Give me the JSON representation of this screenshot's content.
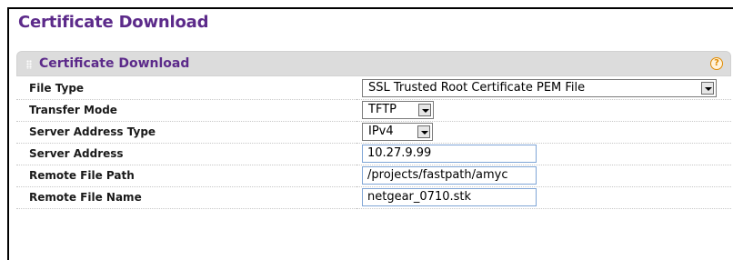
{
  "page": {
    "title": "Certificate Download"
  },
  "panel": {
    "title": "Certificate Download",
    "help_icon": "help-icon",
    "help_glyph": "?"
  },
  "form": {
    "file_type": {
      "label": "File Type",
      "value": "SSL Trusted Root Certificate PEM File"
    },
    "transfer_mode": {
      "label": "Transfer Mode",
      "value": "TFTP"
    },
    "server_address_type": {
      "label": "Server Address Type",
      "value": "IPv4"
    },
    "server_address": {
      "label": "Server Address",
      "value": "10.27.9.99"
    },
    "remote_file_path": {
      "label": "Remote File Path",
      "value": "/projects/fastpath/amyc"
    },
    "remote_file_name": {
      "label": "Remote File Name",
      "value": "netgear_0710.stk"
    }
  },
  "colors": {
    "title": "#5c2a8a",
    "panel_header_bg": "#dcdcdc",
    "help_icon": "#e08a00",
    "input_border": "#7fa5d6"
  }
}
